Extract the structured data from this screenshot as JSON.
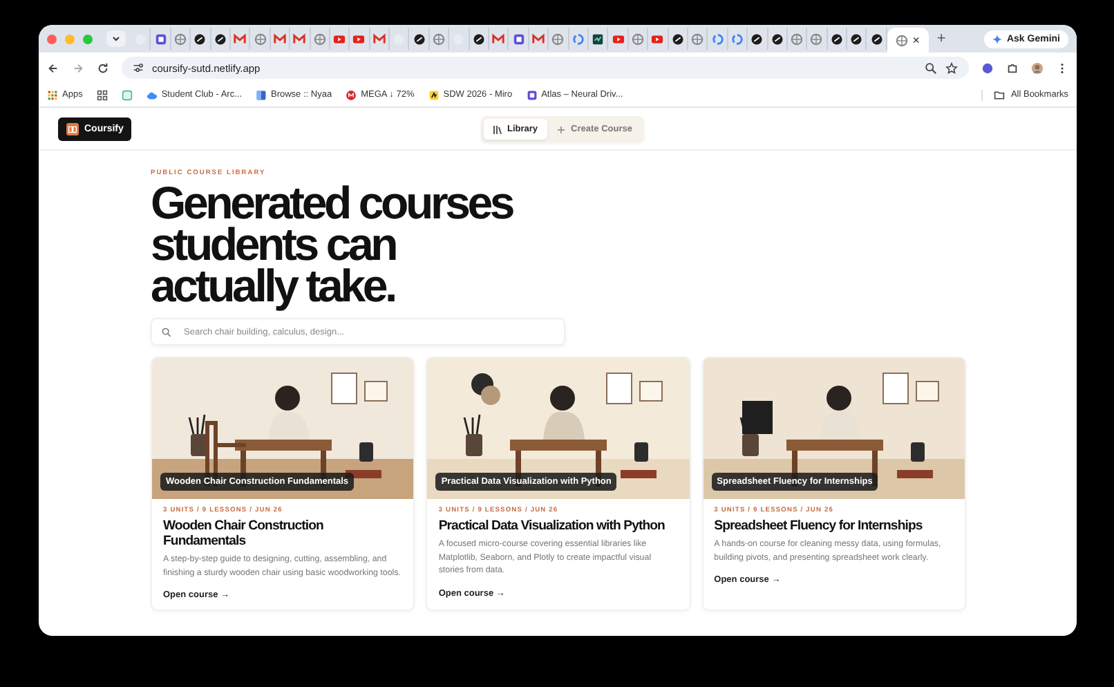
{
  "browser": {
    "tabs": [
      {
        "kind": "blank",
        "selected": false
      },
      {
        "kind": "purple",
        "selected": false
      },
      {
        "kind": "globe",
        "selected": false
      },
      {
        "kind": "dark",
        "selected": false
      },
      {
        "kind": "dark",
        "selected": false
      },
      {
        "kind": "gmail",
        "selected": false
      },
      {
        "kind": "globe",
        "selected": false
      },
      {
        "kind": "gmail",
        "selected": false
      },
      {
        "kind": "gmail",
        "selected": false
      },
      {
        "kind": "globe",
        "selected": false
      },
      {
        "kind": "youtube",
        "selected": false
      },
      {
        "kind": "youtube",
        "selected": false
      },
      {
        "kind": "gmail",
        "selected": false
      },
      {
        "kind": "blank",
        "selected": false
      },
      {
        "kind": "dark",
        "selected": false
      },
      {
        "kind": "globe",
        "selected": false
      },
      {
        "kind": "blank",
        "selected": false
      },
      {
        "kind": "dark",
        "selected": false
      },
      {
        "kind": "gmail",
        "selected": false
      },
      {
        "kind": "purple",
        "selected": false
      },
      {
        "kind": "gmail",
        "selected": false
      },
      {
        "kind": "globe",
        "selected": false
      },
      {
        "kind": "google",
        "selected": false
      },
      {
        "kind": "green",
        "selected": false
      },
      {
        "kind": "youtube",
        "selected": false
      },
      {
        "kind": "globe",
        "selected": false
      },
      {
        "kind": "youtube",
        "selected": false
      },
      {
        "kind": "dark",
        "selected": false
      },
      {
        "kind": "globe",
        "selected": false
      },
      {
        "kind": "google",
        "selected": false
      },
      {
        "kind": "google",
        "selected": false
      },
      {
        "kind": "dark",
        "selected": false
      },
      {
        "kind": "dark",
        "selected": false
      },
      {
        "kind": "globe",
        "selected": false
      },
      {
        "kind": "globe",
        "selected": false
      },
      {
        "kind": "dark",
        "selected": false
      },
      {
        "kind": "dark",
        "selected": false
      },
      {
        "kind": "dark",
        "selected": false
      },
      {
        "kind": "globe",
        "selected": true
      }
    ],
    "close_tab": "×",
    "new_tab": "+",
    "gemini": "Ask Gemini",
    "url": "coursify-sutd.netlify.app",
    "bookmarks": [
      {
        "kind": "apps",
        "label": "Apps"
      },
      {
        "kind": "grid"
      },
      {
        "kind": "teal"
      },
      {
        "kind": "cloud",
        "label": "Student Club - Arc..."
      },
      {
        "kind": "blue",
        "label": "Browse :: Nyaa"
      },
      {
        "kind": "red",
        "label": "MEGA ↓ 72%"
      },
      {
        "kind": "yellow",
        "label": "SDW 2026 - Miro"
      },
      {
        "kind": "purple",
        "label": "Atlas – Neural Driv..."
      }
    ],
    "all_bookmarks": "All Bookmarks"
  },
  "app": {
    "logo": "Coursify",
    "nav": [
      {
        "kind": "library",
        "label": "Library",
        "selected": true
      },
      {
        "kind": "create",
        "label": "Create Course",
        "selected": false
      }
    ],
    "eyebrow": "PUBLIC COURSE LIBRARY",
    "heading": [
      "Generated courses",
      "students can",
      "actually take."
    ],
    "search": {
      "placeholder": "Search chair building, calculus, design..."
    },
    "courses": [
      {
        "caption": "Wooden Chair Construction Fundamentals",
        "meta": "3 UNITS / 9 LESSONS / JUN 26",
        "title": "Wooden Chair Construction Fundamentals",
        "description": "A step-by-step guide to designing, cutting, assembling, and finishing a sturdy wooden chair using basic woodworking tools.",
        "link": "Open course",
        "arrow": "→"
      },
      {
        "caption": "Practical Data Visualization with Python",
        "meta": "3 UNITS / 9 LESSONS / JUN 26",
        "title": "Practical Data Visualization with Python",
        "description": "A focused micro-course covering essential libraries like Matplotlib, Seaborn, and Plotly to create impactful visual stories from data.",
        "link": "Open course",
        "arrow": "→"
      },
      {
        "caption": "Spreadsheet Fluency for Internships",
        "meta": "3 UNITS / 9 LESSONS / JUN 26",
        "title": "Spreadsheet Fluency for Internships",
        "description": "A hands-on course for cleaning messy data, using formulas, building pivots, and presenting spreadsheet work clearly.",
        "link": "Open course",
        "arrow": "→"
      }
    ]
  }
}
